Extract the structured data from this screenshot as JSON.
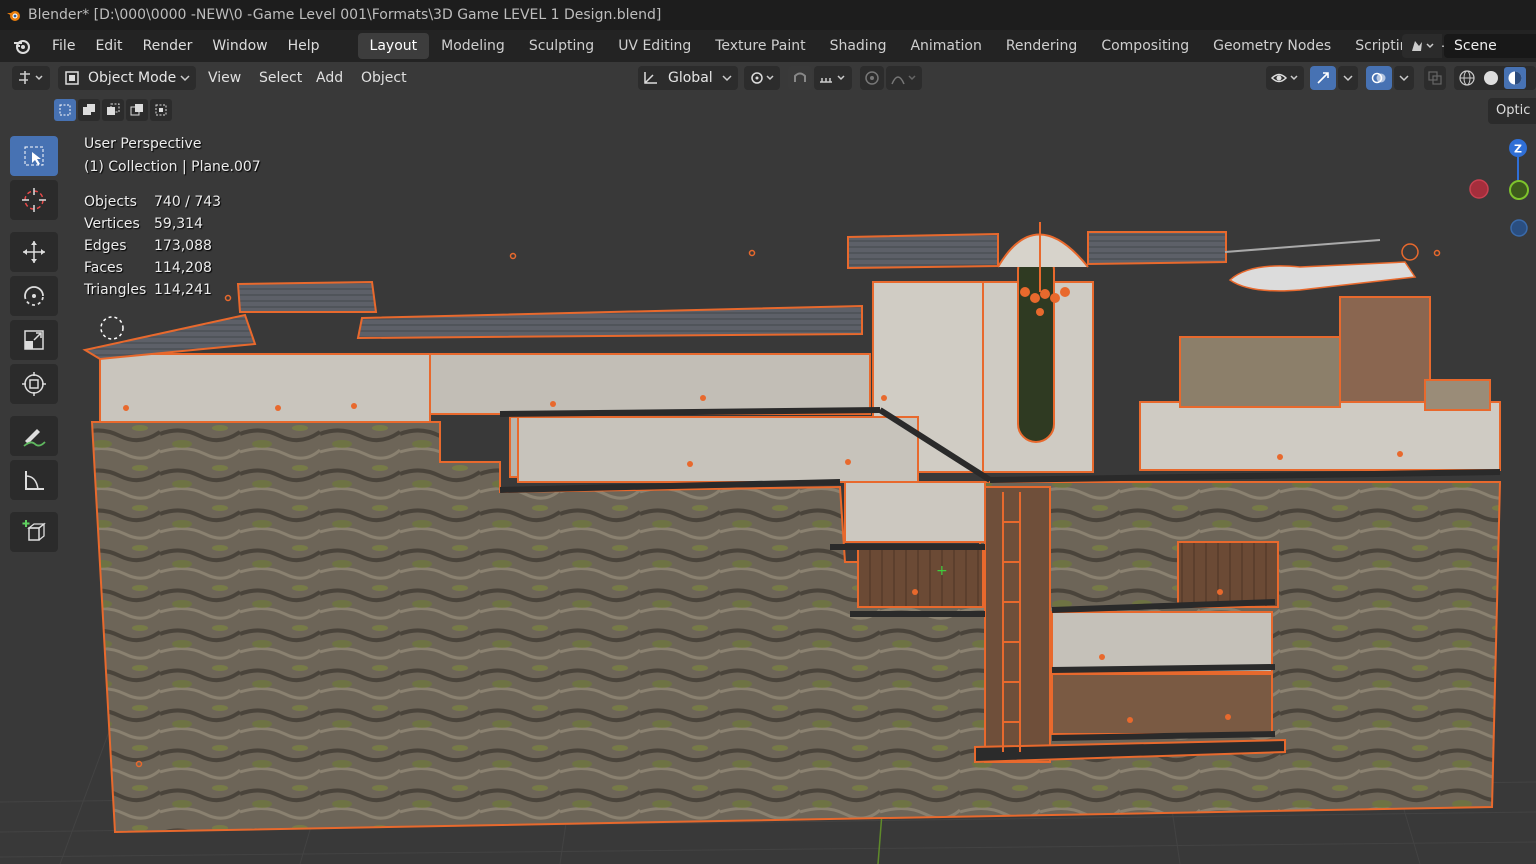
{
  "window": {
    "title": "Blender* [D:\\000\\0000 -NEW\\0 -Game Level 001\\Formats\\3D Game LEVEL 1 Design.blend]"
  },
  "menubar": {
    "items": [
      "File",
      "Edit",
      "Render",
      "Window",
      "Help"
    ]
  },
  "workspaces": [
    "Layout",
    "Modeling",
    "Sculpting",
    "UV Editing",
    "Texture Paint",
    "Shading",
    "Animation",
    "Rendering",
    "Compositing",
    "Geometry Nodes",
    "Scripting"
  ],
  "active_workspace": "Layout",
  "scene": {
    "name": "Scene"
  },
  "viewport_header": {
    "mode": "Object Mode",
    "menus": [
      "View",
      "Select",
      "Add",
      "Object"
    ],
    "orientation": "Global",
    "options_label": "Optic"
  },
  "overlay_info": {
    "perspective": "User Perspective",
    "collection": "(1) Collection | Plane.007",
    "stats": [
      {
        "label": "Objects",
        "value": "740 / 743"
      },
      {
        "label": "Vertices",
        "value": "59,314"
      },
      {
        "label": "Edges",
        "value": "173,088"
      },
      {
        "label": "Faces",
        "value": "114,208"
      },
      {
        "label": "Triangles",
        "value": "114,241"
      }
    ]
  },
  "gizmo": {
    "z_label": "Z"
  },
  "colors": {
    "accent": "#4772b3",
    "selection": "#e8692d",
    "viewport_bg": "#393939"
  }
}
